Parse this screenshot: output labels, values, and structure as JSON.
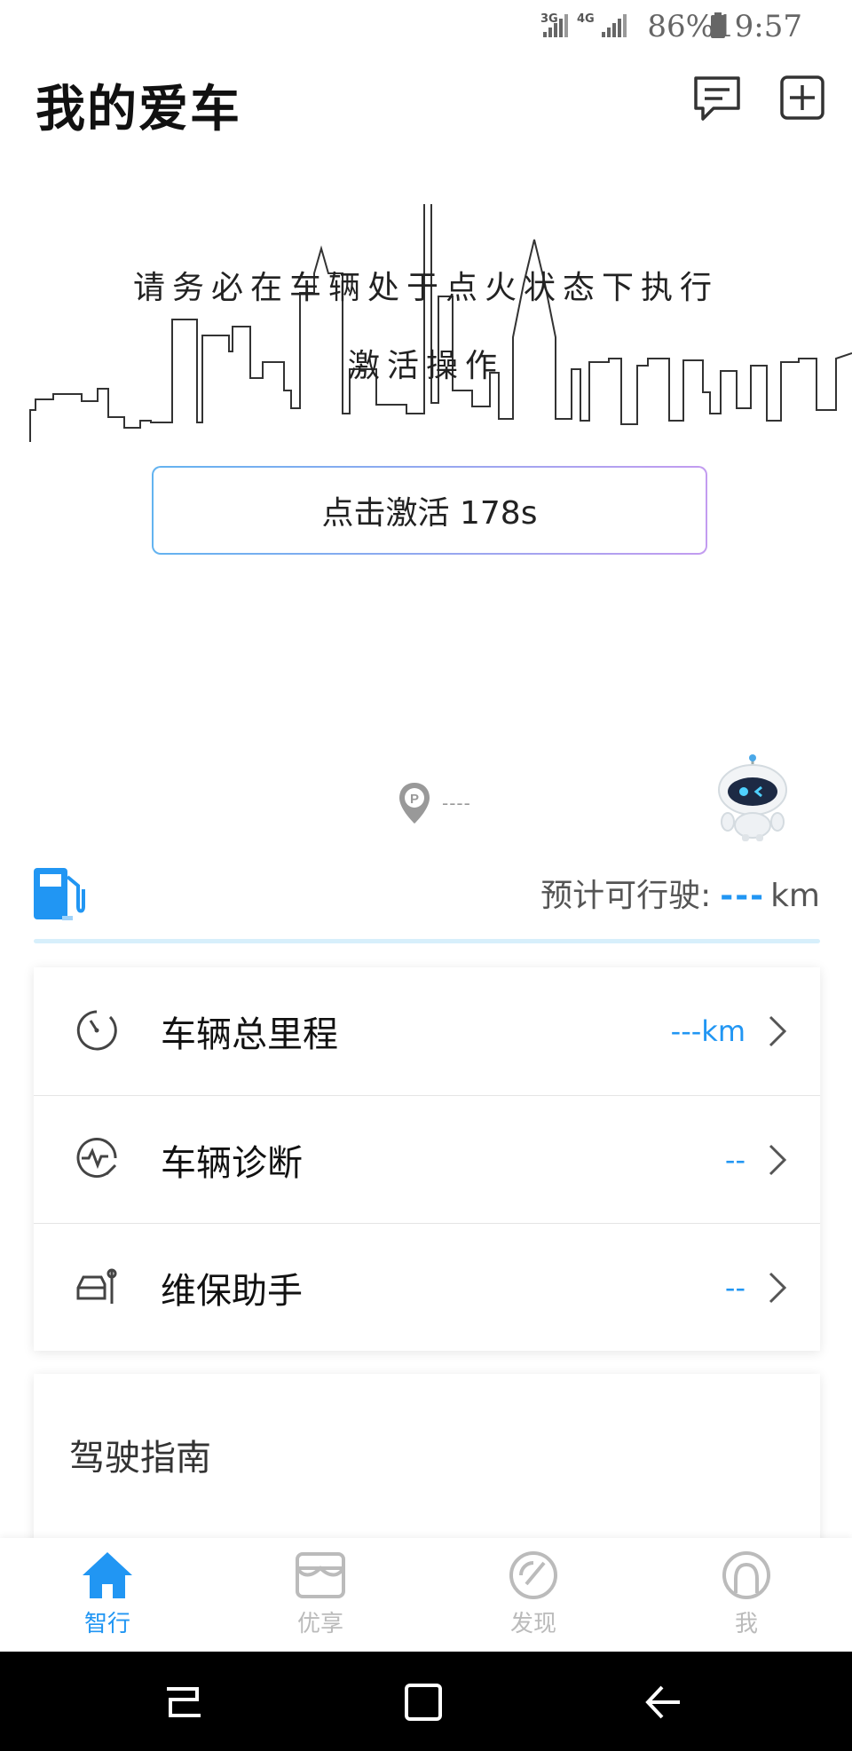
{
  "status_bar": {
    "net1": "3G",
    "net2": "4G",
    "battery": "86%",
    "time": "19:57"
  },
  "header": {
    "title": "我的爱车",
    "message_icon": "message-icon",
    "add_icon": "plus-icon"
  },
  "activation": {
    "notice_line1": "请务必在车辆处于点火状态下执行",
    "notice_line2": "激活操作",
    "button_label": "点击激活 178s"
  },
  "parking": {
    "icon": "parking-pin-icon",
    "location": "----"
  },
  "fuel": {
    "icon": "fuel-pump-icon",
    "range_label": "预计可行驶:",
    "range_value": "---",
    "range_unit": "km"
  },
  "info_rows": [
    {
      "label": "车辆总里程",
      "value": "---km",
      "icon": "odometer-icon"
    },
    {
      "label": "车辆诊断",
      "value": "--",
      "icon": "diagnosis-icon"
    },
    {
      "label": "维保助手",
      "value": "--",
      "icon": "maintenance-icon"
    }
  ],
  "guide": {
    "title": "驾驶指南"
  },
  "bottom_nav": [
    {
      "label": "智行",
      "icon": "home-icon",
      "active": true
    },
    {
      "label": "优享",
      "icon": "shop-icon",
      "active": false
    },
    {
      "label": "发现",
      "icon": "compass-icon",
      "active": false
    },
    {
      "label": "我",
      "icon": "profile-icon",
      "active": false
    }
  ],
  "colors": {
    "accent": "#2196f3",
    "inactive": "#bbbbbb",
    "divider": "#d7effb"
  }
}
